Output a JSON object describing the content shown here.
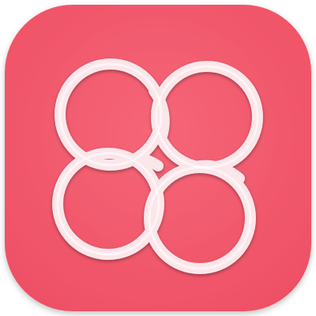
{
  "icon": {
    "name": "four-interlocking-rings-app-icon",
    "background_color": "#f45b6f",
    "background_edge_color": "#ee4f64",
    "ring_color": "#fbe6ea",
    "ring_highlight_color": "#ffffff",
    "ring_shadow_color": "#e8b6c0"
  }
}
